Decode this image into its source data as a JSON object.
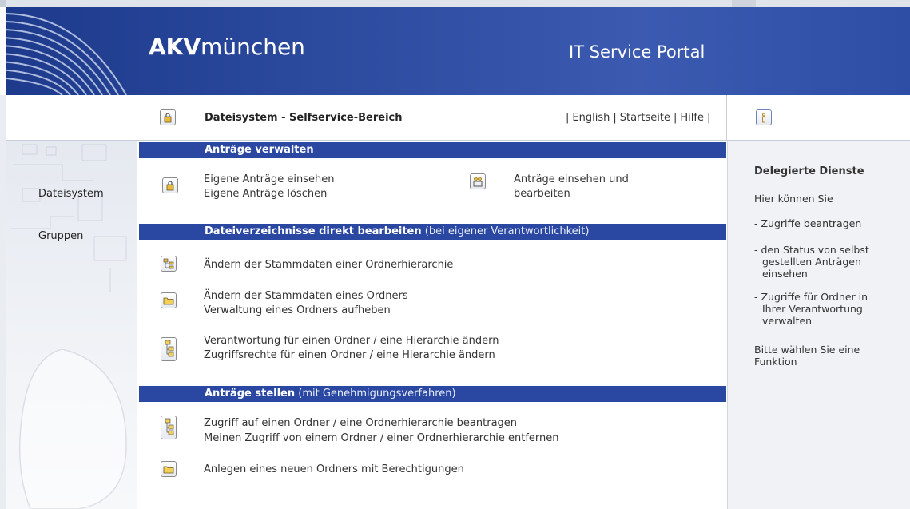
{
  "header": {
    "logo_bold": "AKV",
    "logo_rest": "münchen",
    "portal": "IT Service Portal"
  },
  "topbar": {
    "page_title": "Dateisystem - Selfservice-Bereich",
    "links": [
      "English",
      "Startseite",
      "Hilfe"
    ],
    "sep": "|"
  },
  "sidebar": {
    "items": [
      "Dateisystem",
      "Gruppen"
    ]
  },
  "sections": [
    {
      "title": "Anträge verwalten",
      "subtitle": ""
    },
    {
      "title": "Dateiverzeichnisse direkt bearbeiten",
      "subtitle": "(bei eigener Verantwortlichkeit)"
    },
    {
      "title": "Anträge stellen",
      "subtitle": "(mit Genehmigungsverfahren)"
    }
  ],
  "section1": {
    "own_view": "Eigene Anträge einsehen",
    "own_delete": "Eigene Anträge löschen",
    "view_edit_line1": "Anträge einsehen und",
    "view_edit_line2": "bearbeiten"
  },
  "section2": {
    "hierarchy_master": "Ändern der Stammdaten einer Ordnerhierarchie",
    "folder_master": "Ändern der Stammdaten eines Ordners",
    "folder_release": "Verwaltung eines Ordners aufheben",
    "responsibility": "Verantwortung für einen Ordner / eine Hierarchie ändern",
    "access_rights": "Zugriffsrechte für einen Ordner / eine Hierarchie ändern"
  },
  "section3": {
    "request_access": "Zugriff auf einen Ordner / eine Ordnerhierarchie beantragen",
    "remove_access": "Meinen Zugriff von einem Ordner / einer Ordnerhierarchie entfernen",
    "create_folder": "Anlegen eines neuen Ordners mit Berechtigungen"
  },
  "rightpanel": {
    "heading": "Delegierte Dienste",
    "intro": "Hier können Sie",
    "b1": "- Zugriffe beantragen",
    "b2_l1": "- den Status von selbst",
    "b2_l2": "gestellten Anträgen",
    "b2_l3": "einsehen",
    "b3_l1": "- Zugriffe für Ordner in",
    "b3_l2": "Ihrer Verantwortung",
    "b3_l3": "verwalten",
    "outro_l1": "Bitte wählen Sie eine",
    "outro_l2": "Funktion"
  },
  "colors": {
    "header_blue": "#2c4a9e",
    "section_blue": "#2a48a2"
  }
}
